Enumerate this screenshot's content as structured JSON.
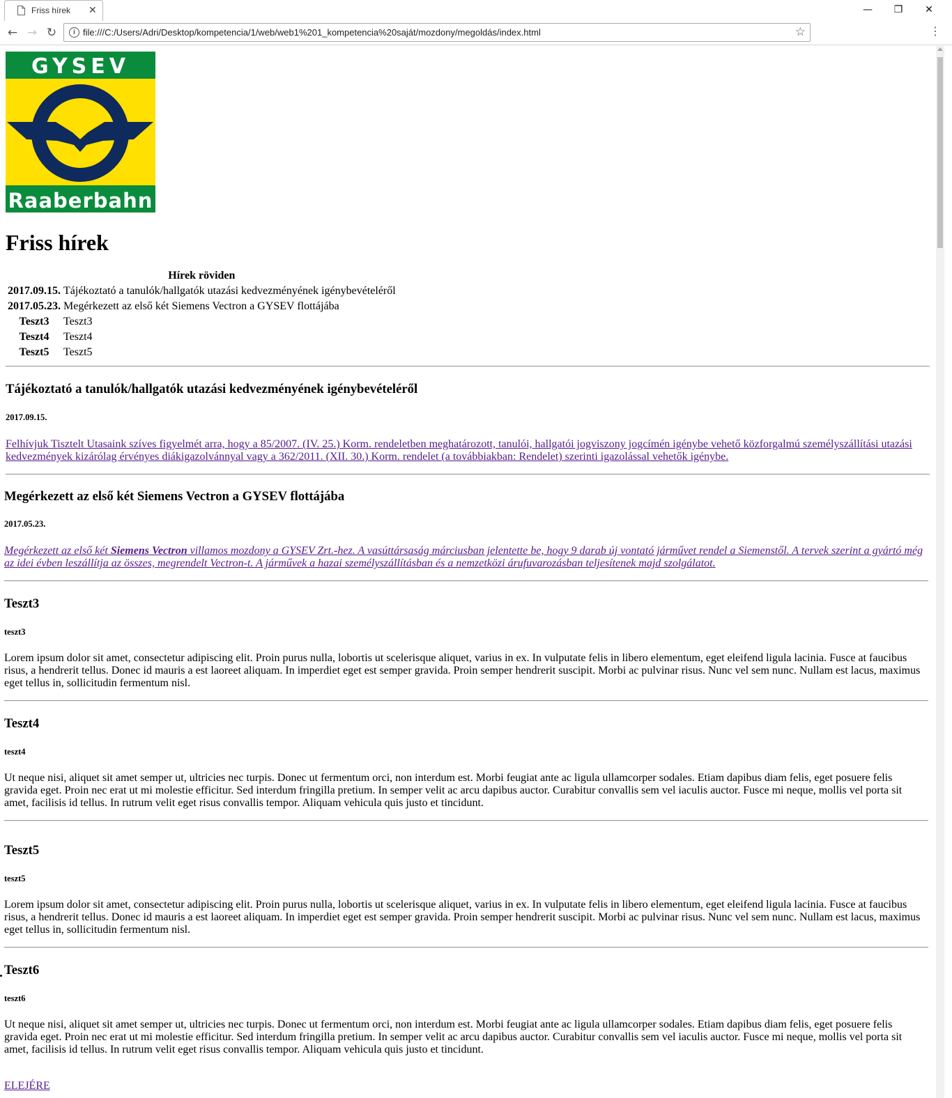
{
  "browser": {
    "tab_title": "Friss hírek",
    "tab_close": "✕",
    "url": "file:///C:/Users/Adri/Desktop/kompetencia/1/web/web1%201_kompetencia%20saját/mozdony/megoldás/index.html",
    "info_icon": "i",
    "nav_back": "←",
    "nav_forward": "→",
    "nav_reload": "↻",
    "star": "☆",
    "menu": "⋮",
    "win_minimize": "—",
    "win_maximize": "❐",
    "win_close": "✕"
  },
  "logo": {
    "top_text": "GYSEV",
    "bottom_text": "Raaberbahn",
    "colors": {
      "green": "#0a8c3c",
      "yellow": "#ffe000",
      "navy": "#0f2a5c"
    }
  },
  "page": {
    "title": "Friss hírek",
    "table": {
      "caption": "Hírek röviden",
      "rows": [
        {
          "key": "2017.09.15.",
          "value": "Tájékoztató a tanulók/hallgatók utazási kedvezményének igénybevételéről"
        },
        {
          "key": "2017.05.23.",
          "value": "Megérkezett az első két Siemens Vectron a GYSEV flottájába"
        },
        {
          "key": "Teszt3",
          "value": "Teszt3"
        },
        {
          "key": "Teszt4",
          "value": "Teszt4"
        },
        {
          "key": "Teszt5",
          "value": "Teszt5"
        }
      ]
    },
    "articles": [
      {
        "title": "Tájékoztató a tanulók/hallgatók utazási kedvezményének igénybevételéről",
        "date": "2017.09.15.",
        "link_line1": "Felhívjuk Tisztelt Utasaink szíves figyelmét arra, hogy a 85/2007. (IV. 25.) Korm. rendeletben meghatározott, tanulói, hallgatói jogviszony jogcímén igénybe vehető közforgalmú személyszállítási utazási",
        "link_line2": "kedvezmények kizárólag érvényes diákigazolvánnyal vagy a 362/2011. (XII. 30.) Korm. rendelet (a továbbiakban: Rendelet) szerinti igazolással vehetők igénybe."
      },
      {
        "title": "Megérkezett az első két Siemens Vectron a GYSEV flottájába",
        "date": "2017.05.23.",
        "link_pre": "Megérkezett az első két ",
        "link_bold": "Siemens Vectron",
        "link_post": " villamos mozdony a GYSEV Zrt.-hez. A vasúttársaság márciusban jelentette be, hogy 9 darab új vontató járművet rendel a Siemenstől. A tervek szerint a gyártó még",
        "link_line2": "az idei évben leszállítja az összes, megrendelt Vectron-t. A járművek a hazai személyszállításban és a nemzetközi árufuvarozásban teljesítenek majd szolgálatot."
      },
      {
        "title": "Teszt3",
        "date": "teszt3",
        "body": "Lorem ipsum dolor sit amet, consectetur adipiscing elit. Proin purus nulla, lobortis ut scelerisque aliquet, varius in ex. In vulputate felis in libero elementum, eget eleifend ligula lacinia. Fusce at faucibus risus, a hendrerit tellus. Donec id mauris a est laoreet aliquam. In imperdiet eget est semper gravida. Proin semper hendrerit suscipit. Morbi ac pulvinar risus. Nunc vel sem nunc. Nullam est lacus, maximus eget tellus in, sollicitudin fermentum nisl."
      },
      {
        "title": "Teszt4",
        "date": "teszt4",
        "body": "Ut neque nisi, aliquet sit amet semper ut, ultricies nec turpis. Donec ut fermentum orci, non interdum est. Morbi feugiat ante ac ligula ullamcorper sodales. Etiam dapibus diam felis, eget posuere felis gravida eget. Proin nec erat ut mi molestie efficitur. Sed interdum fringilla pretium. In semper velit ac arcu dapibus auctor. Curabitur convallis sem vel iaculis auctor. Fusce mi neque, mollis vel porta sit amet, facilisis id tellus. In rutrum velit eget risus convallis tempor. Aliquam vehicula quis justo et tincidunt."
      },
      {
        "title": "Teszt5",
        "date": "teszt5",
        "body": "Lorem ipsum dolor sit amet, consectetur adipiscing elit. Proin purus nulla, lobortis ut scelerisque aliquet, varius in ex. In vulputate felis in libero elementum, eget eleifend ligula lacinia. Fusce at faucibus risus, a hendrerit tellus. Donec id mauris a est laoreet aliquam. In imperdiet eget est semper gravida. Proin semper hendrerit suscipit. Morbi ac pulvinar risus. Nunc vel sem nunc. Nullam est lacus, maximus eget tellus in, sollicitudin fermentum nisl."
      },
      {
        "title": "Teszt6",
        "date": "teszt6",
        "body": "Ut neque nisi, aliquet sit amet semper ut, ultricies nec turpis. Donec ut fermentum orci, non interdum est. Morbi feugiat ante ac ligula ullamcorper sodales. Etiam dapibus diam felis, eget posuere felis gravida eget. Proin nec erat ut mi molestie efficitur. Sed interdum fringilla pretium. In semper velit ac arcu dapibus auctor. Curabitur convallis sem vel iaculis auctor. Fusce mi neque, mollis vel porta sit amet, facilisis id tellus. In rutrum velit eget risus convallis tempor. Aliquam vehicula quis justo et tincidunt."
      }
    ],
    "back_to_top": "ELEJÉRE"
  }
}
